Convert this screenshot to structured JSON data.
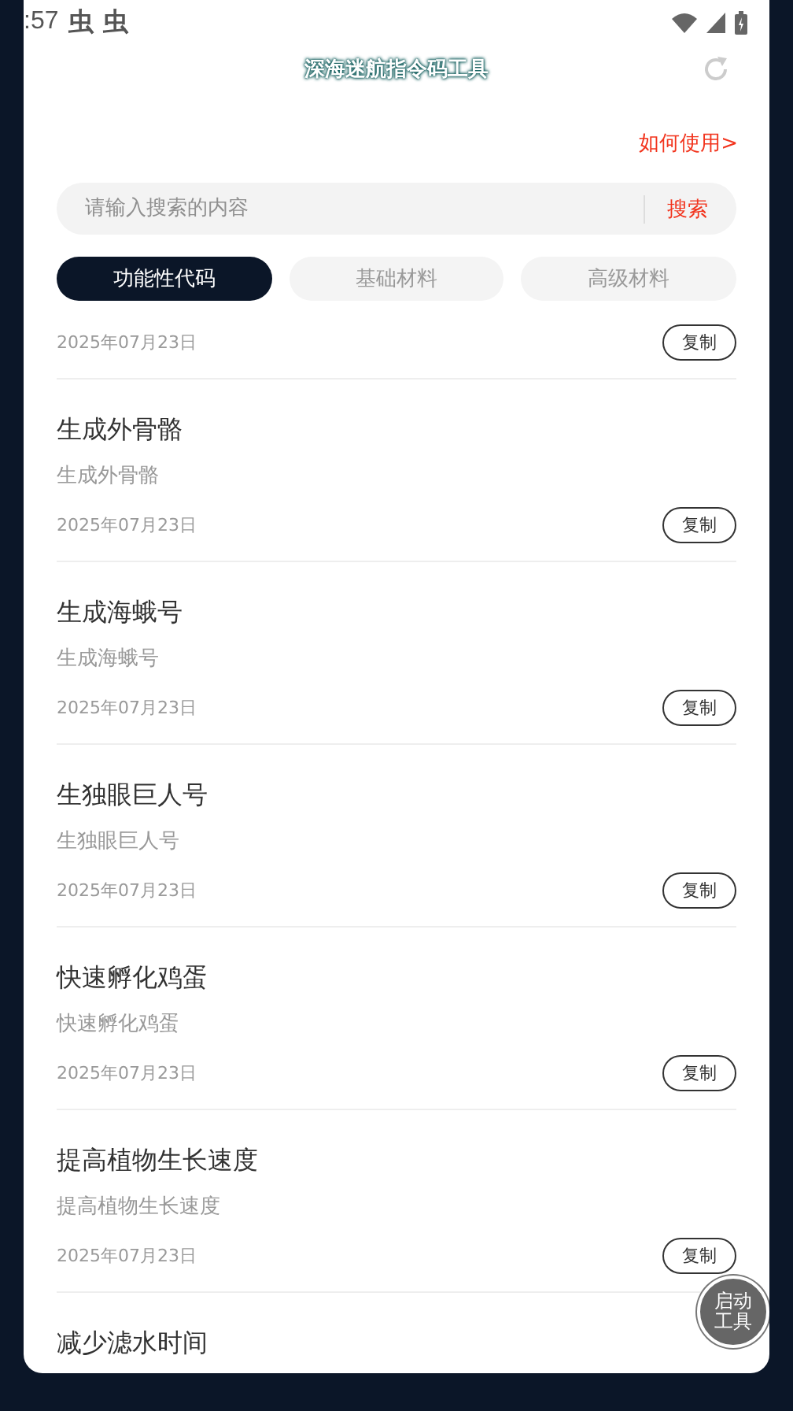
{
  "status_bar": {
    "time": ":57",
    "notification_icons": [
      "虫",
      "虫"
    ]
  },
  "header": {
    "title": "深海迷航指令码工具"
  },
  "help_link": "如何使用>",
  "search": {
    "placeholder": "请输入搜索的内容",
    "button": "搜索"
  },
  "tabs": [
    {
      "label": "功能性代码",
      "selected": true
    },
    {
      "label": "基础材料",
      "selected": false
    },
    {
      "label": "高级材料",
      "selected": false
    }
  ],
  "items": [
    {
      "date": "2025年07月23日",
      "button": "复制"
    },
    {
      "title": "生成外骨骼",
      "subtitle": "生成外骨骼",
      "date": "2025年07月23日",
      "button": "复制"
    },
    {
      "title": "生成海蛾号",
      "subtitle": "生成海蛾号",
      "date": "2025年07月23日",
      "button": "复制"
    },
    {
      "title": "生独眼巨人号",
      "subtitle": "生独眼巨人号",
      "date": "2025年07月23日",
      "button": "复制"
    },
    {
      "title": "快速孵化鸡蛋",
      "subtitle": "快速孵化鸡蛋",
      "date": "2025年07月23日",
      "button": "复制"
    },
    {
      "title": "提高植物生长速度",
      "subtitle": "提高植物生长速度",
      "date": "2025年07月23日",
      "button": "复制"
    },
    {
      "title": "减少滤水时间"
    }
  ],
  "floating_button": {
    "lines": [
      "启动",
      "工具"
    ]
  }
}
